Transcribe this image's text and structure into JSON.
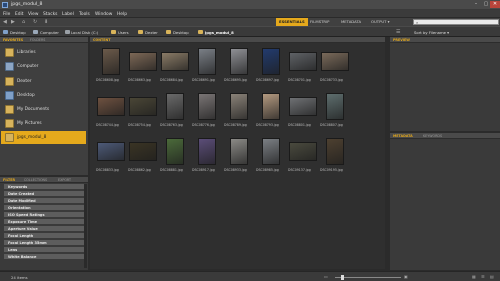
{
  "app": {
    "title": "jpgs_modul_8",
    "window_controls": [
      "–",
      "▢",
      "✕"
    ]
  },
  "menu": [
    "File",
    "Edit",
    "View",
    "Stacks",
    "Label",
    "Tools",
    "Window",
    "Help"
  ],
  "workspaces": {
    "items": [
      "ESSENTIALS",
      "FILMSTRIP",
      "METADATA",
      "OUTPUT ▾"
    ],
    "active": "ESSENTIALS"
  },
  "search": {
    "placeholder": ""
  },
  "breadcrumb": [
    "Desktop",
    "Computer",
    "Local Disk (C:)",
    "Users",
    "Dexter",
    "Desktop",
    "jpgs_modul_8"
  ],
  "sort": {
    "label": "Sort by Filename ▾"
  },
  "left_panel": {
    "tabs": [
      "FAVORITES",
      "FOLDERS"
    ],
    "favorites": [
      {
        "label": "Libraries",
        "selected": false
      },
      {
        "label": "Computer",
        "selected": false
      },
      {
        "label": "Dexter",
        "selected": false
      },
      {
        "label": "Desktop",
        "selected": false
      },
      {
        "label": "My Documents",
        "selected": false
      },
      {
        "label": "My Pictures",
        "selected": false
      },
      {
        "label": "jpgs_modul_8",
        "selected": true
      }
    ],
    "filter_tabs": [
      "FILTER",
      "COLLECTIONS",
      "EXPORT"
    ],
    "filters": [
      "Keywords",
      "Date Created",
      "Date Modified",
      "Orientation",
      "ISO Speed Ratings",
      "Exposure Time",
      "Aperture Value",
      "Focal Length",
      "Focal Length 35mm",
      "Lens",
      "White Balance"
    ]
  },
  "content": {
    "tab": "CONTENT",
    "items": [
      {
        "filename": "DSC08608.jpg",
        "color": "#6b5a4a",
        "orientation": "portrait"
      },
      {
        "filename": "DSC08663.jpg",
        "color": "#7d6856",
        "orientation": "landscape"
      },
      {
        "filename": "DSC08684.jpg",
        "color": "#8a7b66",
        "orientation": "landscape"
      },
      {
        "filename": "DSC08691.jpg",
        "color": "#7a7f86",
        "orientation": "portrait"
      },
      {
        "filename": "DSC08695.jpg",
        "color": "#8f9095",
        "orientation": "portrait"
      },
      {
        "filename": "DSC08697.jpg",
        "color": "#223b6e",
        "orientation": "portrait"
      },
      {
        "filename": "DSC08701.jpg",
        "color": "#5f6266",
        "orientation": "landscape"
      },
      {
        "filename": "DSC08733.jpg",
        "color": "#7a6a5a",
        "orientation": "landscape"
      },
      {
        "filename": "DSC08744.jpg",
        "color": "#6e5140",
        "orientation": "landscape"
      },
      {
        "filename": "DSC08754.jpg",
        "color": "#4a4636",
        "orientation": "landscape"
      },
      {
        "filename": "DSC08763.jpg",
        "color": "#6a6a6a",
        "orientation": "portrait"
      },
      {
        "filename": "DSC08776.jpg",
        "color": "#7a7575",
        "orientation": "portrait"
      },
      {
        "filename": "DSC08789.jpg",
        "color": "#8a8278",
        "orientation": "portrait"
      },
      {
        "filename": "DSC08793.jpg",
        "color": "#b49a80",
        "orientation": "portrait"
      },
      {
        "filename": "DSC08801.jpg",
        "color": "#6f7174",
        "orientation": "landscape"
      },
      {
        "filename": "DSC08807.jpg",
        "color": "#5e6e6e",
        "orientation": "portrait"
      },
      {
        "filename": "DSC08833.jpg",
        "color": "#4d5a78",
        "orientation": "landscape"
      },
      {
        "filename": "DSC08862.jpg",
        "color": "#3a3424",
        "orientation": "landscape"
      },
      {
        "filename": "DSC08881.jpg",
        "color": "#4b6a3a",
        "orientation": "portrait"
      },
      {
        "filename": "DSC08917.jpg",
        "color": "#5b4d78",
        "orientation": "portrait"
      },
      {
        "filename": "DSC08933.jpg",
        "color": "#8b8a86",
        "orientation": "portrait"
      },
      {
        "filename": "DSC08985.jpg",
        "color": "#7b7f84",
        "orientation": "portrait"
      },
      {
        "filename": "DSC09137.jpg",
        "color": "#4a4a3e",
        "orientation": "landscape"
      },
      {
        "filename": "DSC09195.jpg",
        "color": "#4d4030",
        "orientation": "portrait"
      }
    ]
  },
  "right_panel": {
    "preview_tab": "PREVIEW",
    "meta_tabs": [
      "METADATA",
      "KEYWORDS"
    ]
  },
  "status": {
    "count": "24 items",
    "thumb_size_fraction": 0.12
  },
  "colors": {
    "accent": "#e5a91c",
    "panel": "#3f3f3f",
    "content_bg": "#2f2f2f"
  }
}
